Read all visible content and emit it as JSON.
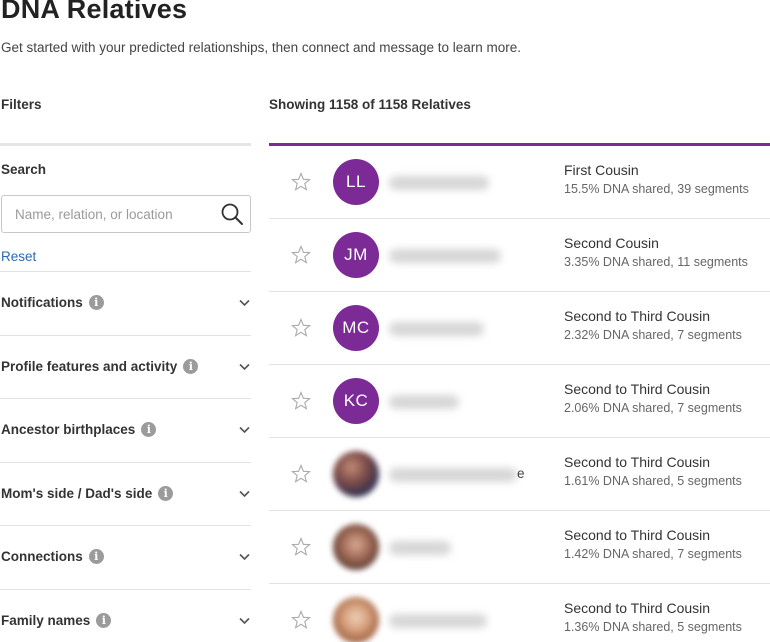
{
  "page": {
    "title": "DNA Relatives",
    "subtitle": "Get started with your predicted relationships, then connect and message to learn more."
  },
  "sidebar": {
    "filters_label": "Filters",
    "search_label": "Search",
    "search_placeholder": "Name, relation, or location",
    "reset_label": "Reset",
    "filters": [
      {
        "label": "Notifications"
      },
      {
        "label": "Profile features and activity"
      },
      {
        "label": "Ancestor birthplaces"
      },
      {
        "label": "Mom's side / Dad's side"
      },
      {
        "label": "Connections"
      },
      {
        "label": "Family names"
      }
    ]
  },
  "main": {
    "showing_label": "Showing 1158 of 1158 Relatives",
    "matches": [
      {
        "initials": "LL",
        "relationship": "First Cousin",
        "dna": "15.5% DNA shared, 39 segments"
      },
      {
        "initials": "JM",
        "relationship": "Second Cousin",
        "dna": "3.35% DNA shared, 11 segments"
      },
      {
        "initials": "MC",
        "relationship": "Second to Third Cousin",
        "dna": "2.32% DNA shared, 7 segments"
      },
      {
        "initials": "KC",
        "relationship": "Second to Third Cousin",
        "dna": "2.06% DNA shared, 7 segments"
      },
      {
        "initials": "",
        "name_tail": "e",
        "relationship": "Second to Third Cousin",
        "dna": "1.61% DNA shared, 5 segments"
      },
      {
        "initials": "",
        "relationship": "Second to Third Cousin",
        "dna": "1.42% DNA shared, 7 segments"
      },
      {
        "initials": "",
        "relationship": "Second to Third Cousin",
        "dna": "1.36% DNA shared, 5 segments"
      }
    ]
  },
  "colors": {
    "accent": "#7b2a96",
    "link": "#2a6ab0"
  }
}
